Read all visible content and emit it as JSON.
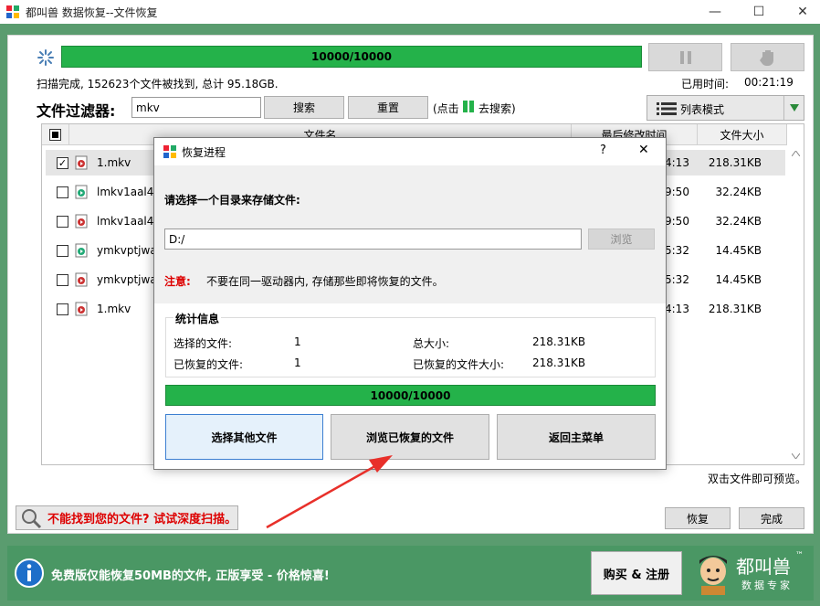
{
  "window": {
    "title": "都叫兽 数据恢复--文件恢复",
    "minimize": "—",
    "maximize": "☐",
    "close": "✕"
  },
  "scan": {
    "progress_text": "10000/10000",
    "progress": 1.0,
    "status": "扫描完成, 152623个文件被找到, 总计 95.18GB.",
    "elapsed_label": "已用时间:",
    "elapsed_value": "00:21:19"
  },
  "filter": {
    "label": "文件过滤器:",
    "value": "mkv",
    "search_label": "搜索",
    "reset_label": "重置",
    "hint_prefix": "(点击",
    "hint_suffix": "去搜索)"
  },
  "view_mode": {
    "label": "列表模式"
  },
  "table": {
    "columns": [
      "文件名",
      "最后修改时间",
      "文件大小"
    ],
    "rows": [
      {
        "name": "1.mkv",
        "time": "4:13",
        "size": "218.31KB",
        "checked": true
      },
      {
        "name": "lmkv1aal4jo",
        "time": "9:50",
        "size": "32.24KB",
        "checked": false
      },
      {
        "name": "lmkv1aal4jo",
        "time": "9:50",
        "size": "32.24KB",
        "checked": false
      },
      {
        "name": "ymkvptjwa4",
        "time": "5:32",
        "size": "14.45KB",
        "checked": false
      },
      {
        "name": "ymkvptjwa4",
        "time": "5:32",
        "size": "14.45KB",
        "checked": false
      },
      {
        "name": "1.mkv",
        "time": "4:13",
        "size": "218.31KB",
        "checked": false
      }
    ],
    "preview_hint": "双击文件即可预览。"
  },
  "deep_scan": {
    "label": "不能找到您的文件? 试试深度扫描。"
  },
  "actions": {
    "recover": "恢复",
    "finish": "完成"
  },
  "footer": {
    "notice": "免费版仅能恢复50MB的文件, 正版享受 - 价格惊喜!",
    "buy_label": "购买 & 注册",
    "brand": "都叫兽",
    "brand_sub": "数据专家",
    "brand_tm": "™"
  },
  "dialog": {
    "title": "恢复进程",
    "help": "?",
    "close": "✕",
    "prompt": "请选择一个目录来存储文件:",
    "path_value": "D:/",
    "browse_label": "浏览",
    "note_label": "注意:",
    "note_text": "不要在同一驱动器内, 存储那些即将恢复的文件。",
    "stats_title": "统计信息",
    "selected_label": "选择的文件:",
    "selected_value": "1",
    "total_size_label": "总大小:",
    "total_size_value": "218.31KB",
    "recovered_label": "已恢复的文件:",
    "recovered_value": "1",
    "recovered_size_label": "已恢复的文件大小:",
    "recovered_size_value": "218.31KB",
    "progress_text": "10000/10000",
    "btn_select_other": "选择其他文件",
    "btn_browse_recovered": "浏览已恢复的文件",
    "btn_back_main": "返回主菜单"
  },
  "colors": {
    "accent_green": "#24b24a",
    "footer_green": "#4a9764",
    "warning_red": "#dd0000"
  }
}
